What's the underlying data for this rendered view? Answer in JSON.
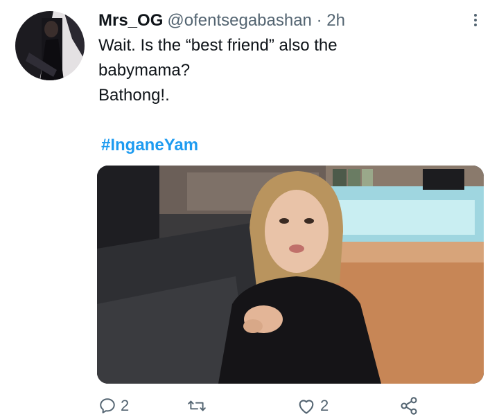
{
  "tweet": {
    "display_name": "Mrs_OG",
    "handle": "@ofentsegabashan",
    "separator": "·",
    "time": "2h",
    "text_lines": [
      "Wait. Is the “best friend” also the",
      "babymama?",
      "Bathong!."
    ],
    "hashtag": "#InganeYam"
  },
  "actions": {
    "reply_count": "2",
    "retweet_count": "",
    "like_count": "2"
  },
  "icons": {
    "more": "more-vertical-icon",
    "reply": "reply-icon",
    "retweet": "retweet-icon",
    "like": "heart-icon",
    "share": "share-icon"
  },
  "colors": {
    "text": "#0f1419",
    "secondary": "#536471",
    "link": "#1d9bf0"
  }
}
